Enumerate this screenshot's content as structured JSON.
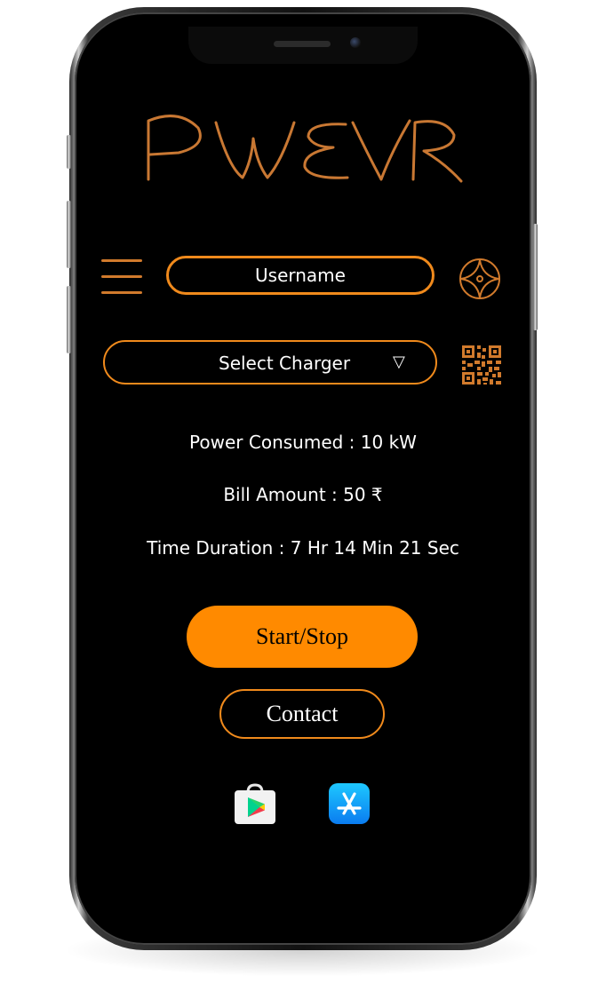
{
  "app": {
    "logo_text": "PWEVR"
  },
  "header": {
    "username": "Username",
    "menu_icon": "hamburger-menu-icon",
    "compass_icon": "compass-star-icon"
  },
  "charger": {
    "select_label": "Select Charger",
    "caret": "▽",
    "qr_icon": "qr-code-icon"
  },
  "stats": {
    "power_consumed": "Power Consumed : 10 kW",
    "bill_amount": "Bill Amount : 50 ₹",
    "time_duration": "Time Duration : 7 Hr 14 Min 21 Sec"
  },
  "actions": {
    "start_stop_label": "Start/Stop",
    "contact_label": "Contact"
  },
  "stores": {
    "play_store_icon": "google-play-store-icon",
    "app_store_icon": "apple-app-store-icon"
  },
  "colors": {
    "accent": "#f08a1c",
    "button_fill": "#ff8a00",
    "logo": "#c97833",
    "background": "#000000"
  }
}
